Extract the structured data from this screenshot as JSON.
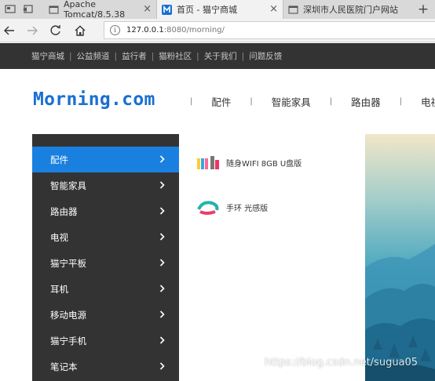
{
  "browser": {
    "tabs": [
      {
        "title": "Apache Tomcat/8.5.38",
        "active": false
      },
      {
        "title": "首页 - 猫宁商城",
        "active": true
      },
      {
        "title": "深圳市人民医院门户网站",
        "active": false
      }
    ],
    "close_glyph": "×",
    "new_tab_glyph": "+",
    "info_glyph": "i",
    "url_host": "127.0.0.1",
    "url_path": ":8080/morning/"
  },
  "topnav": {
    "links": [
      "猫宁商城",
      "公益频道",
      "益行者",
      "猫粉社区",
      "关于我们",
      "问题反馈"
    ],
    "separator": "|"
  },
  "header": {
    "logo": "Morning.com",
    "separator": "|",
    "nav": [
      "配件",
      "智能家具",
      "路由器",
      "电视"
    ]
  },
  "sidebar": {
    "items": [
      "配件",
      "智能家具",
      "路由器",
      "电视",
      "猫宁平板",
      "耳机",
      "移动电源",
      "猫宁手机",
      "笔记本"
    ],
    "active_index": 0
  },
  "dropdown": {
    "products": [
      "随身WIFI 8GB U盘版",
      "手环 光感版"
    ]
  },
  "watermark": "https://blog.csdn.net/sugua05",
  "colors": {
    "accent": "#1a80e0",
    "logo": "#1a6fd1",
    "dark_bar": "#333333"
  }
}
